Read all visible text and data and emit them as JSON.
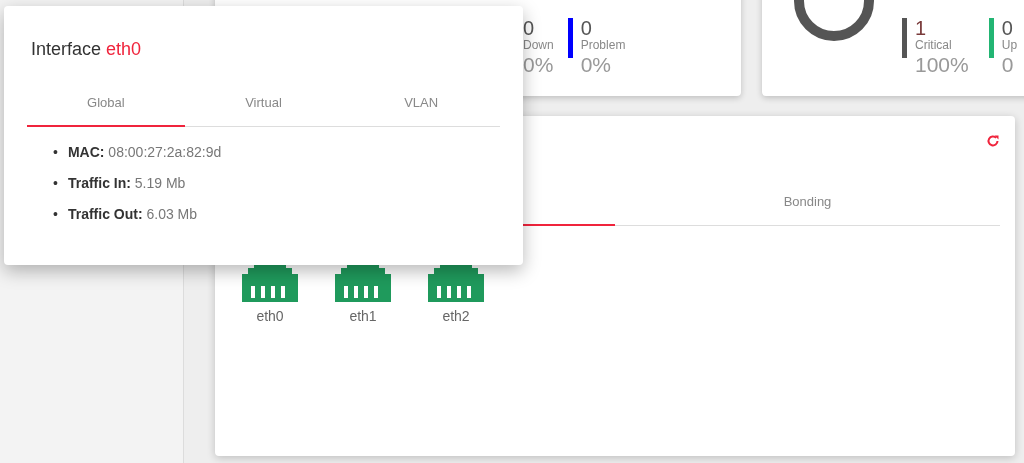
{
  "summary_cards": [
    {
      "kind": "plain",
      "stats": [
        {
          "count": "0",
          "label": "Down",
          "percent": "0%"
        },
        {
          "count": "0",
          "label": "Problem",
          "percent": "0%",
          "color": "#0000ff"
        }
      ]
    },
    {
      "kind": "donut",
      "stats": [
        {
          "count": "1",
          "label": "Critical",
          "percent": "100%",
          "color": "#555555"
        },
        {
          "count": "0",
          "label": "Up",
          "percent": "0",
          "color": "#22b573"
        }
      ]
    }
  ],
  "interfaces_card": {
    "tabs": [
      {
        "selected": true
      },
      {
        "label": "Bonding",
        "selected": false
      }
    ],
    "interfaces": [
      {
        "name": "eth0"
      },
      {
        "name": "eth1"
      },
      {
        "name": "eth2"
      }
    ]
  },
  "popup": {
    "title": "Interface",
    "interface": "eth0",
    "tabs": [
      {
        "label": "Global",
        "selected": true
      },
      {
        "label": "Virtual",
        "selected": false
      },
      {
        "label": "VLAN",
        "selected": false
      }
    ],
    "details": [
      {
        "bullet": "•",
        "label": "MAC:",
        "value": "08:00:27:2a:82:9d"
      },
      {
        "bullet": "•",
        "label": "Traffic In:",
        "value": "5.19 Mb"
      },
      {
        "bullet": "•",
        "label": "Traffic Out:",
        "value": "6.03 Mb"
      }
    ]
  }
}
